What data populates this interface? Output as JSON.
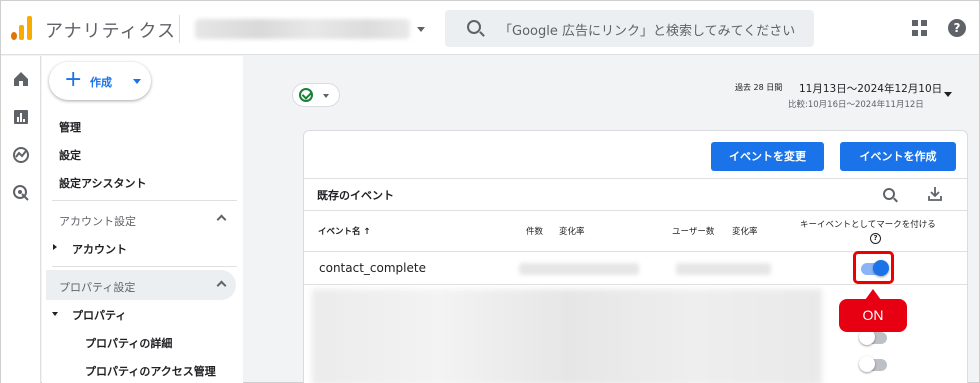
{
  "header": {
    "app_title": "アナリティクス",
    "search_placeholder": "「Google 広告にリンク」と検索してみてください",
    "help_glyph": "?"
  },
  "sidebar": {
    "create_label": "作成",
    "links": [
      "管理",
      "設定",
      "設定アシスタント"
    ],
    "account_section": "アカウント設定",
    "account_item": "アカウント",
    "property_section": "プロパティ設定",
    "property_item": "プロパティ",
    "property_details": "プロパティの詳細",
    "property_access": "プロパティのアクセス管理"
  },
  "date": {
    "prefix": "過去 28 日間",
    "range": "11月13日〜2024年12月10日",
    "compare": "比較:10月16日〜2024年11月12日"
  },
  "events": {
    "edit_button": "イベントを変更",
    "create_button": "イベントを作成",
    "title": "既存のイベント",
    "columns": {
      "name": "イベント名 ↑",
      "count": "件数",
      "count_change": "変化率",
      "users": "ユーザー数",
      "users_change": "変化率",
      "mark_key": "キーイベントとしてマークを付ける"
    },
    "help_glyph": "?",
    "rows": [
      {
        "name": "contact_complete",
        "key_event": true
      }
    ]
  },
  "callout": {
    "label": "ON"
  },
  "colors": {
    "accent": "#1a73e8",
    "callout": "#e60012",
    "logo_orange": "#f9ab00",
    "logo_dark": "#e37400"
  }
}
